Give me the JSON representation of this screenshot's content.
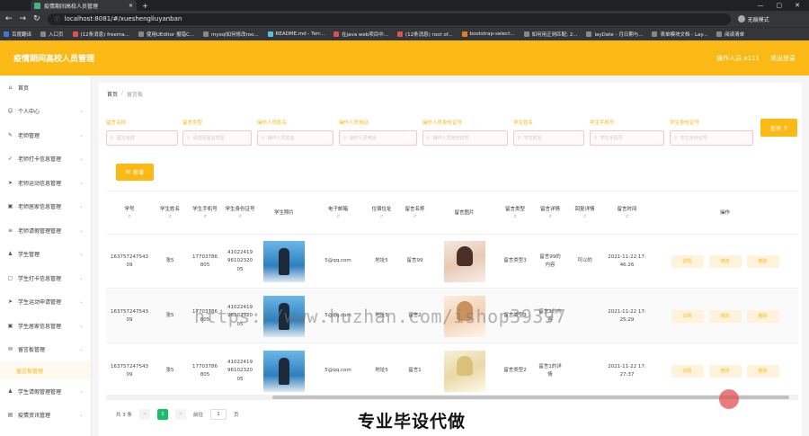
{
  "browser": {
    "tab_title": "疫情期间高校人员管理",
    "url": "localhost:8081/#/xueshengliuyanban",
    "profile_label": "无痕模式",
    "bookmarks": [
      {
        "label": "百度翻译",
        "color": "#3a7bd5"
      },
      {
        "label": "入口页",
        "color": "#888888"
      },
      {
        "label": "(12条消息) freema...",
        "color": "#d9534f"
      },
      {
        "label": "使用UEditor 报错C...",
        "color": "#888888"
      },
      {
        "label": "mysql如何修改roo...",
        "color": "#888888"
      },
      {
        "label": "README.md - Terr...",
        "color": "#5bc0de"
      },
      {
        "label": "在java web项目中...",
        "color": "#d9534f"
      },
      {
        "label": "(12条消息) root of...",
        "color": "#d9534f"
      },
      {
        "label": "bootstrap-select...",
        "color": "#e67e22"
      },
      {
        "label": "如何用正则匹配; 2...",
        "color": "#888888"
      },
      {
        "label": "layDate - 月日期与...",
        "color": "#888888"
      },
      {
        "label": "表单模块文档 - Lay...",
        "color": "#888888"
      },
      {
        "label": "阅读清单",
        "color": "#888888"
      }
    ]
  },
  "header": {
    "title": "疫情期间高校人员管理",
    "user_label": "操作人员 a111",
    "logout_label": "退出登录"
  },
  "sidebar": {
    "items": [
      {
        "label": "首页",
        "icon": "home-icon",
        "glyph": "⌂",
        "chev": false
      },
      {
        "label": "个人中心",
        "icon": "user-icon",
        "glyph": "☺",
        "chev": true
      },
      {
        "label": "老师管理",
        "icon": "teacher-icon",
        "glyph": "✎",
        "chev": true
      },
      {
        "label": "老师打卡信息管理",
        "icon": "checkin-icon",
        "glyph": "✓",
        "chev": true
      },
      {
        "label": "老师运动信息管理",
        "icon": "send-icon",
        "glyph": "➤",
        "chev": true
      },
      {
        "label": "老师居家信息管理",
        "icon": "house-icon",
        "glyph": "▣",
        "chev": true
      },
      {
        "label": "老师请假管理管理",
        "icon": "list-icon",
        "glyph": "≡",
        "chev": true
      },
      {
        "label": "学生管理",
        "icon": "student-icon",
        "glyph": "♟",
        "chev": true
      },
      {
        "label": "学生打卡信息管理",
        "icon": "bracket-icon",
        "glyph": "▢",
        "chev": true
      },
      {
        "label": "学生运动申请管理",
        "icon": "send-icon",
        "glyph": "➤",
        "chev": true
      },
      {
        "label": "学生居家信息管理",
        "icon": "house-icon",
        "glyph": "▣",
        "chev": true
      },
      {
        "label": "留言板管理",
        "icon": "message-icon",
        "glyph": "✉",
        "chev": true
      },
      {
        "label": "学生请假管理管理",
        "icon": "student-icon",
        "glyph": "♟",
        "chev": true
      },
      {
        "label": "疫情资讯管理",
        "icon": "news-icon",
        "glyph": "▤",
        "chev": true
      }
    ],
    "active_sub": "留言板管理"
  },
  "breadcrumb": {
    "home": "首页",
    "sep": "/",
    "current": "留言板"
  },
  "filters": [
    {
      "label": "留言名称",
      "placeholder": "留言名称"
    },
    {
      "label": "留言类型",
      "placeholder": "请选择留言类型"
    },
    {
      "label": "操作人员姓名",
      "placeholder": "操作人员姓名"
    },
    {
      "label": "操作人员电话",
      "placeholder": "操作人员电话"
    },
    {
      "label": "操作人员身份证号",
      "placeholder": "操作人员身份证号"
    },
    {
      "label": "学生姓名",
      "placeholder": "学生姓名"
    },
    {
      "label": "学生手机号",
      "placeholder": "学生手机号"
    },
    {
      "label": "学生身份证号",
      "placeholder": "学生身份证号"
    }
  ],
  "buttons": {
    "search": "查询",
    "add": "新增"
  },
  "table": {
    "columns": [
      "学号",
      "学生姓名",
      "学生手机号",
      "学生身份证号",
      "学生照片",
      "电子邮箱",
      "住宿住址",
      "留言名称",
      "留言图片",
      "留言类型",
      "留言详情",
      "回复详情",
      "留言时间",
      "操作"
    ],
    "rows": [
      {
        "no": "16375724754309",
        "name": "张5",
        "phone": "17703786805",
        "idcard": "410224199610232005",
        "email": "5@qq.com",
        "addr": "地址5",
        "msg_name": "留言99",
        "type": "留言类型3",
        "detail": "留言99的内容",
        "reply": "可以的",
        "time": "2021-11-22 17:46:26"
      },
      {
        "no": "16375724754309",
        "name": "张5",
        "phone": "17703786805",
        "idcard": "410224199610232005",
        "email": "5@qq.com",
        "addr": "地址5",
        "msg_name": "留言2",
        "type": "留言类型3",
        "detail": "留言2的内容",
        "reply": "",
        "time": "2021-11-22 17:25:29"
      },
      {
        "no": "16375724754309",
        "name": "张5",
        "phone": "17703786805",
        "idcard": "410224199610232005",
        "email": "5@qq.com",
        "addr": "地址5",
        "msg_name": "留言1",
        "type": "留言类型2",
        "detail": "留言1的详情",
        "reply": "",
        "time": "2021-11-22 17:27:37"
      }
    ],
    "ops": [
      "详情",
      "修改",
      "删除"
    ]
  },
  "pager": {
    "total": "共 3 条",
    "prev": "<",
    "current": "1",
    "next": ">",
    "goto": "前往",
    "page_input": "1",
    "page_unit": "页"
  },
  "overlay": {
    "watermark": "https://www.huzhan.com/ishop39397",
    "banner": "专业毕设代做"
  }
}
